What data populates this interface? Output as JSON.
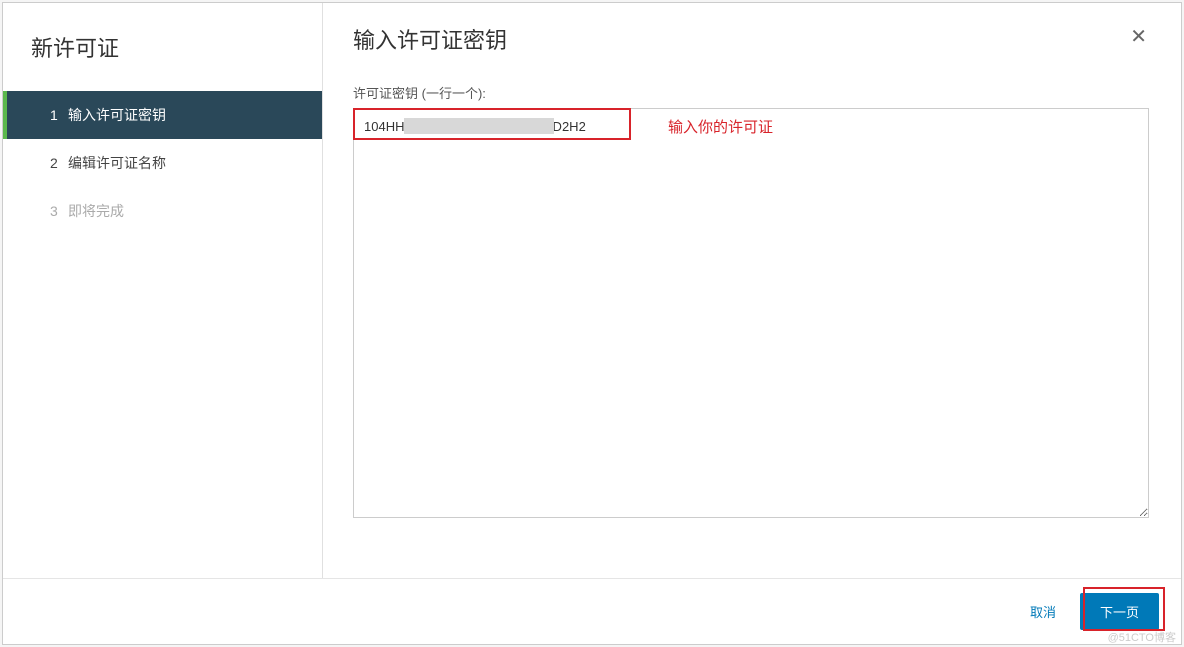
{
  "sidebar": {
    "title": "新许可证",
    "steps": [
      {
        "number": "1",
        "label": "输入许可证密钥",
        "state": "active"
      },
      {
        "number": "2",
        "label": "编辑许可证名称",
        "state": "normal"
      },
      {
        "number": "3",
        "label": "即将完成",
        "state": "disabled"
      }
    ]
  },
  "main": {
    "title": "输入许可证密钥",
    "field_label": "许可证密钥 (一行一个):",
    "textarea_value": "104HH                                       2D2H2",
    "annotation_text": "输入你的许可证"
  },
  "footer": {
    "cancel_label": "取消",
    "next_label": "下一页"
  },
  "watermark": "@51CTO博客",
  "colors": {
    "primary": "#0079b8",
    "accent_green": "#5bb84d",
    "danger": "#d8232a",
    "sidebar_active_bg": "#2a4859"
  }
}
